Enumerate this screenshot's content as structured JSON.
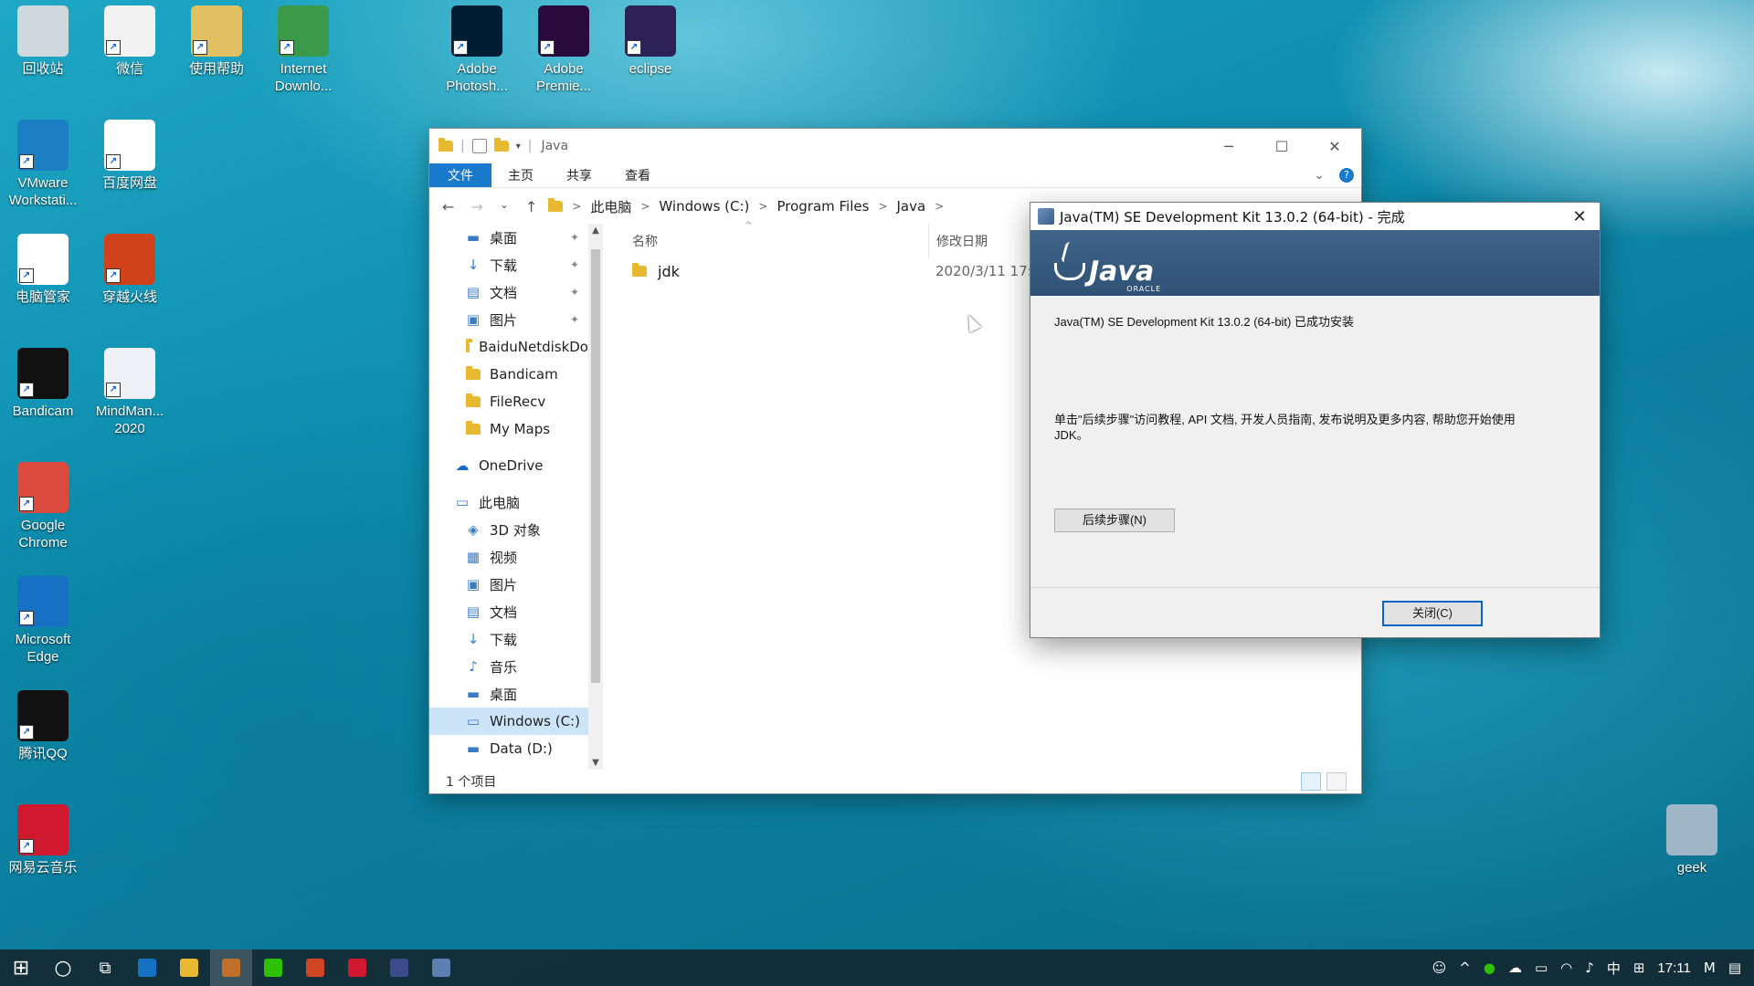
{
  "desktop": {
    "icons": [
      {
        "label": "回收站",
        "icon": "recycle-bin-icon",
        "color": "#cfd8dc"
      },
      {
        "label": "微信",
        "icon": "wechat-icon",
        "color": "#f2f2f2"
      },
      {
        "label": "使用帮助",
        "icon": "help-document-icon",
        "color": "#e0c060"
      },
      {
        "label": "Internet Downlo...",
        "icon": "internet-download-manager-icon",
        "color": "#3a9a4a"
      },
      {
        "label": "Adobe Photosh...",
        "icon": "photoshop-icon",
        "color": "#001d34"
      },
      {
        "label": "Adobe Premie...",
        "icon": "premiere-icon",
        "color": "#2a0a3c"
      },
      {
        "label": "eclipse",
        "icon": "eclipse-icon",
        "color": "#2c2255"
      },
      {
        "label": "VMware Workstati...",
        "icon": "vmware-icon",
        "color": "#1d7fc3"
      },
      {
        "label": "百度网盘",
        "icon": "baidu-netdisk-icon",
        "color": "#ffffff"
      },
      {
        "label": "电脑管家",
        "icon": "pc-manager-icon",
        "color": "#ffffff"
      },
      {
        "label": "穿越火线",
        "icon": "crossfire-icon",
        "color": "#d0421b"
      },
      {
        "label": "Bandicam",
        "icon": "bandicam-icon",
        "color": "#111111"
      },
      {
        "label": "MindMan... 2020",
        "icon": "mindmanager-icon",
        "color": "#eef0f6"
      },
      {
        "label": "Google Chrome",
        "icon": "chrome-icon",
        "color": "#dc4a3d"
      },
      {
        "label": "Microsoft Edge",
        "icon": "edge-icon",
        "color": "#1670c4"
      },
      {
        "label": "腾讯QQ",
        "icon": "qq-icon",
        "color": "#111111"
      },
      {
        "label": "网易云音乐",
        "icon": "netease-music-icon",
        "color": "#d0182f"
      },
      {
        "label": "geek",
        "icon": "geek-uninstaller-icon",
        "color": "#9fb6c6"
      }
    ]
  },
  "explorer": {
    "title": "Java",
    "ribbon_tabs": [
      "文件",
      "主页",
      "共享",
      "查看"
    ],
    "breadcrumb": [
      "此电脑",
      "Windows (C:)",
      "Program Files",
      "Java"
    ],
    "nav_items": [
      {
        "label": "桌面",
        "icon": "desktop-icon",
        "pinned": true
      },
      {
        "label": "下载",
        "icon": "download-icon",
        "pinned": true
      },
      {
        "label": "文档",
        "icon": "document-icon",
        "pinned": true
      },
      {
        "label": "图片",
        "icon": "picture-icon",
        "pinned": true
      },
      {
        "label": "BaiduNetdiskDo",
        "icon": "folder-icon"
      },
      {
        "label": "Bandicam",
        "icon": "folder-icon"
      },
      {
        "label": "FileRecv",
        "icon": "folder-icon"
      },
      {
        "label": "My Maps",
        "icon": "folder-icon"
      },
      {
        "label": "OneDrive",
        "icon": "onedrive-icon",
        "top": true
      },
      {
        "label": "此电脑",
        "icon": "this-pc-icon",
        "top": true
      },
      {
        "label": "3D 对象",
        "icon": "3d-objects-icon"
      },
      {
        "label": "视频",
        "icon": "video-icon"
      },
      {
        "label": "图片",
        "icon": "picture-icon"
      },
      {
        "label": "文档",
        "icon": "document-icon"
      },
      {
        "label": "下载",
        "icon": "download-icon"
      },
      {
        "label": "音乐",
        "icon": "music-icon"
      },
      {
        "label": "桌面",
        "icon": "desktop-icon"
      },
      {
        "label": "Windows (C:)",
        "icon": "drive-c-icon",
        "selected": true
      },
      {
        "label": "Data (D:)",
        "icon": "drive-d-icon"
      }
    ],
    "columns": {
      "name": "名称",
      "modified": "修改日期"
    },
    "files": [
      {
        "name": "jdk",
        "modified": "2020/3/11 17:1"
      }
    ],
    "status": "1 个项目"
  },
  "dialog": {
    "title": "Java(TM) SE Development Kit 13.0.2 (64-bit) - 完成",
    "brand": "Java",
    "brand_sub": "ORACLE",
    "message_success": "Java(TM) SE Development Kit 13.0.2 (64-bit) 已成功安装",
    "message_next": "单击\"后续步骤\"访问教程, API 文档, 开发人员指南, 发布说明及更多内容, 帮助您开始使用 JDK。",
    "next_button": "后续步骤(N)",
    "close_button": "关闭(C)"
  },
  "taskbar": {
    "apps": [
      {
        "name": "start-icon"
      },
      {
        "name": "search-icon"
      },
      {
        "name": "task-view-icon"
      },
      {
        "name": "edge-icon",
        "color": "#1670c4"
      },
      {
        "name": "file-explorer-icon",
        "color": "#e8b830"
      },
      {
        "name": "settings-app-icon",
        "color": "#c0702a",
        "active": true
      },
      {
        "name": "wechat-icon",
        "color": "#2dc100"
      },
      {
        "name": "powerpoint-icon",
        "color": "#d04523"
      },
      {
        "name": "netease-music-icon",
        "color": "#d0182f"
      },
      {
        "name": "mindmanager-icon",
        "color": "#3a4a8a"
      },
      {
        "name": "java-installer-icon",
        "color": "#5a7fb0"
      }
    ],
    "ime": "中",
    "time": "17:11"
  }
}
